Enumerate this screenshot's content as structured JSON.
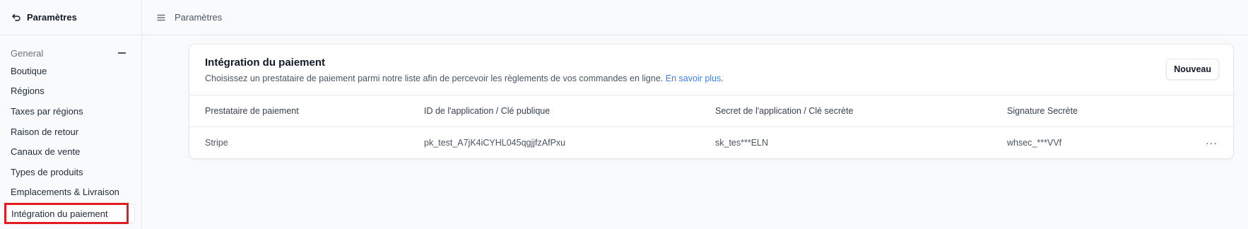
{
  "sidebar": {
    "back_label": "Paramètres",
    "section_title": "General",
    "items": [
      {
        "label": "Boutique"
      },
      {
        "label": "Régions"
      },
      {
        "label": "Taxes par régions"
      },
      {
        "label": "Raison de retour"
      },
      {
        "label": "Canaux de vente"
      },
      {
        "label": "Types de produits"
      },
      {
        "label": "Emplacements & Livraison"
      },
      {
        "label": "Intégration du paiement"
      }
    ]
  },
  "topbar": {
    "title": "Paramètres"
  },
  "card": {
    "title": "Intégration du paiement",
    "description": "Choisissez un prestataire de paiement parmi notre liste afin de percevoir les règlements de vos commandes en ligne. ",
    "link": "En savoir plus",
    "link_suffix": ".",
    "new_button": "Nouveau"
  },
  "table": {
    "columns": [
      "Prestataire de paiement",
      "ID de l'application / Clé publique",
      "Secret de l'application / Clé secrète",
      "Signature Secrète"
    ],
    "rows": [
      {
        "provider": "Stripe",
        "app_id": "pk_test_A7jK4iCYHL045qgjjfzAfPxu",
        "secret": "sk_tes***ELN",
        "signature": "whsec_***VVf",
        "actions": "···"
      }
    ]
  },
  "colors": {
    "accent_link": "#3b82f6",
    "highlight": "#e11d23"
  },
  "icons": {
    "back": "undo-arrow-icon",
    "menu": "hamburger-icon",
    "collapse": "minus-icon",
    "actions": "ellipsis-icon"
  }
}
